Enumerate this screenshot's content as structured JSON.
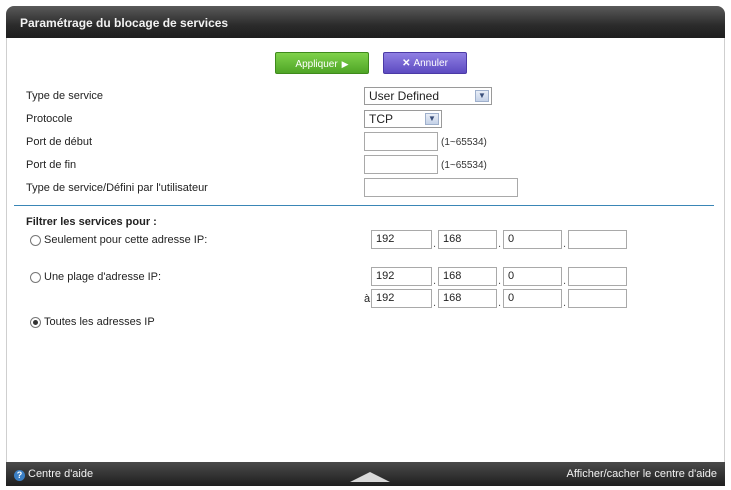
{
  "window": {
    "title": "Paramétrage du blocage de services"
  },
  "toolbar": {
    "apply_label": "Appliquer",
    "apply_icon": "play-arrow-icon",
    "cancel_label": "Annuler",
    "cancel_icon": "close-x-icon"
  },
  "form": {
    "service_type": {
      "label": "Type de service",
      "value": "User Defined"
    },
    "protocol": {
      "label": "Protocole",
      "value": "TCP"
    },
    "start_port": {
      "label": "Port de début",
      "value": "",
      "range": "(1~65534)"
    },
    "end_port": {
      "label": "Port de fin",
      "value": "",
      "range": "(1~65534)"
    },
    "user_defined": {
      "label": "Type de service/Défini par l'utilisateur",
      "value": ""
    }
  },
  "filter": {
    "heading": "Filtrer les services pour :",
    "single_ip": {
      "label": "Seulement pour cette adresse IP:",
      "selected": false,
      "octets": [
        "192",
        "168",
        "0",
        ""
      ]
    },
    "range_ip": {
      "label": "Une plage d'adresse IP:",
      "selected": false,
      "start": [
        "192",
        "168",
        "0",
        ""
      ],
      "end_prefix": "à",
      "end": [
        "192",
        "168",
        "0",
        ""
      ]
    },
    "all_ip": {
      "label": "Toutes les adresses IP",
      "selected": true
    }
  },
  "footer": {
    "help_center": "Centre d'aide",
    "toggle_help": "Afficher/cacher le centre d'aide",
    "help_icon": "help-question-icon",
    "toggle_icon": "triangle-up-icon"
  },
  "colors": {
    "apply": "#5fb533",
    "cancel": "#6e5dd0",
    "divider": "#3a86b6",
    "title_bar": "#2b2b2b"
  }
}
